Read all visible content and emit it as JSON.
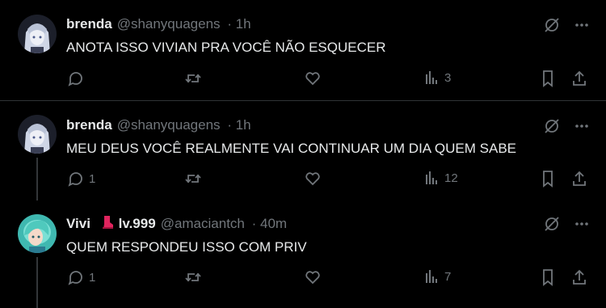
{
  "tweets": [
    {
      "name": "brenda",
      "handle": "@shanyquagens",
      "time": "· 1h",
      "text": "ANOTA ISSO VIVIAN PRA VOCÊ NÃO ESQUECER",
      "replies": "",
      "views": "3"
    },
    {
      "name": "brenda",
      "handle": "@shanyquagens",
      "time": "· 1h",
      "text": "MEU DEUS VOCÊ REALMENTE VAI CONTINUAR UM DIA QUEM SABE",
      "replies": "1",
      "views": "12"
    },
    {
      "name": "Vivi",
      "badge_icon": "red-boot-emoji",
      "level": "lv.999",
      "handle": "@amaciantch",
      "time": "· 40m",
      "text": "QUEM RESPONDEU ISSO COM PRIV",
      "replies": "1",
      "views": "7"
    }
  ],
  "colors": {
    "background": "#000000",
    "text": "#e7e9ea",
    "muted": "#71767b",
    "divider": "#2f3336"
  }
}
